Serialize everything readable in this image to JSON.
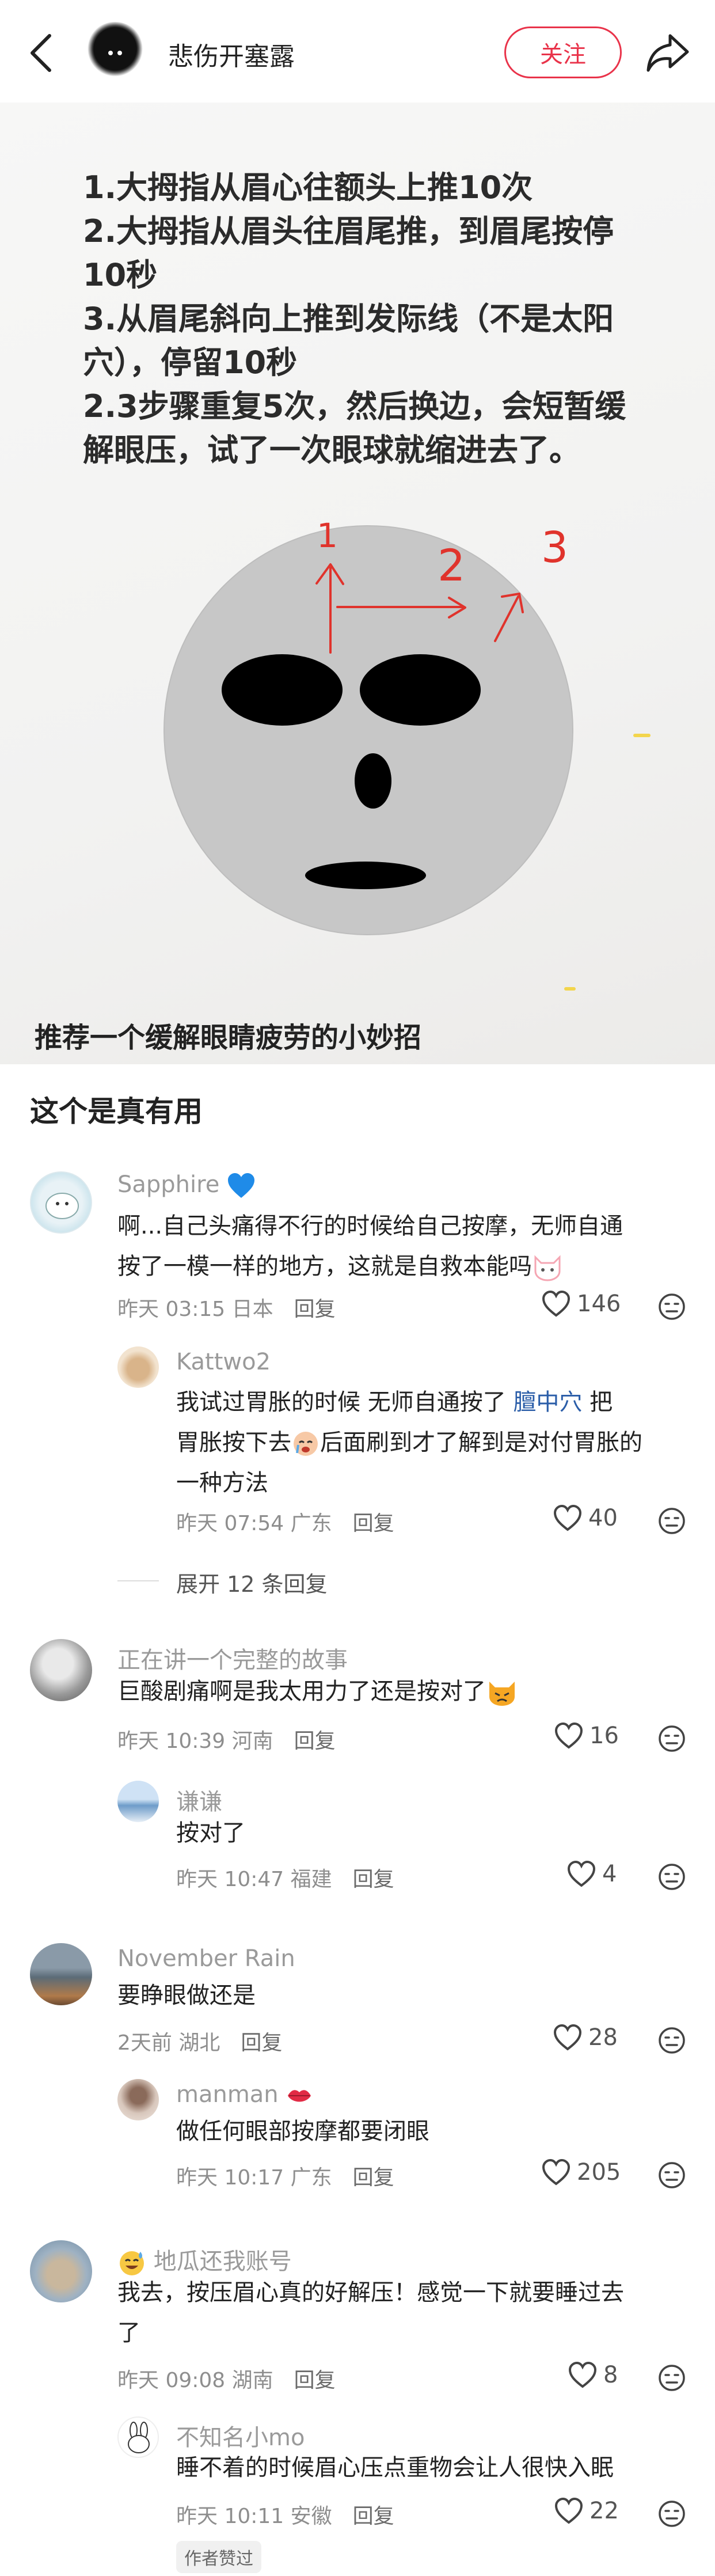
{
  "header": {
    "author": "悲伤开塞露",
    "follow_label": "关注"
  },
  "post": {
    "image_text": [
      "1.大拇指从眉心往额头上推10次",
      "2.大拇指从眉头往眉尾推，到眉尾按停",
      "10秒",
      "3.从眉尾斜向上推到发际线（不是太阳",
      "穴），停留10秒",
      "2.3步骤重复5次，然后换边，会短暂缓",
      "解眼压，试了一次眼球就缩进去了。"
    ],
    "diagram_labels": [
      "1",
      "2",
      "3"
    ],
    "title": "推荐一个缓解眼睛疲劳的小妙招",
    "desc": "这个是真有用"
  },
  "comments": [
    {
      "user": "Sapphire",
      "badge_icon": "blue-heart-icon",
      "text_lines": [
        "啊...自己头痛得不行的时候给自己按摩，无师自通",
        "按了一模一样的地方，这就是自救本能吗"
      ],
      "time": "昨天 03:15 日本",
      "reply_label": "回复",
      "likes": "146",
      "replies": [
        {
          "user": "Kattwo2",
          "text_line1_a": "我试过胃胀的时候 无师自通按了 ",
          "text_line1_link": "膻中穴",
          "text_line1_b": " 把",
          "text_line2_a": "胃胀按下去",
          "text_line2_b": "后面刷到才了解到是对付胃胀的",
          "text_line3": "一种方法",
          "time": "昨天 07:54 广东",
          "reply_label": "回复",
          "likes": "40"
        }
      ],
      "expand_label": "展开 12 条回复"
    },
    {
      "user": "正在讲一个完整的故事",
      "text": "巨酸剧痛啊是我太用力了还是按对了",
      "time": "昨天 10:39 河南",
      "reply_label": "回复",
      "likes": "16",
      "replies": [
        {
          "user": "谦谦",
          "text": "按对了",
          "time": "昨天 10:47 福建",
          "reply_label": "回复",
          "likes": "4"
        }
      ]
    },
    {
      "user": "November Rain",
      "text": "要睁眼做还是",
      "time": "2天前 湖北",
      "reply_label": "回复",
      "likes": "28",
      "replies": [
        {
          "user": "manman",
          "text": "做任何眼部按摩都要闭眼",
          "time": "昨天 10:17 广东",
          "reply_label": "回复",
          "likes": "205"
        }
      ]
    },
    {
      "user": "地瓜还我账号",
      "text_lines": [
        "我去，按压眉心真的好解压！感觉一下就要睡过去",
        "了"
      ],
      "time": "昨天 09:08 湖南",
      "reply_label": "回复",
      "likes": "8",
      "replies": [
        {
          "user": "不知名小mo",
          "text": "睡不着的时候眉心压点重物会让人很快入眠",
          "time": "昨天 10:11 安徽",
          "reply_label": "回复",
          "likes": "22",
          "tag": "作者赞过"
        }
      ]
    }
  ],
  "colors": {
    "accent": "#e9334a",
    "link": "#2a5da8",
    "diagram_red": "#e0332c"
  }
}
